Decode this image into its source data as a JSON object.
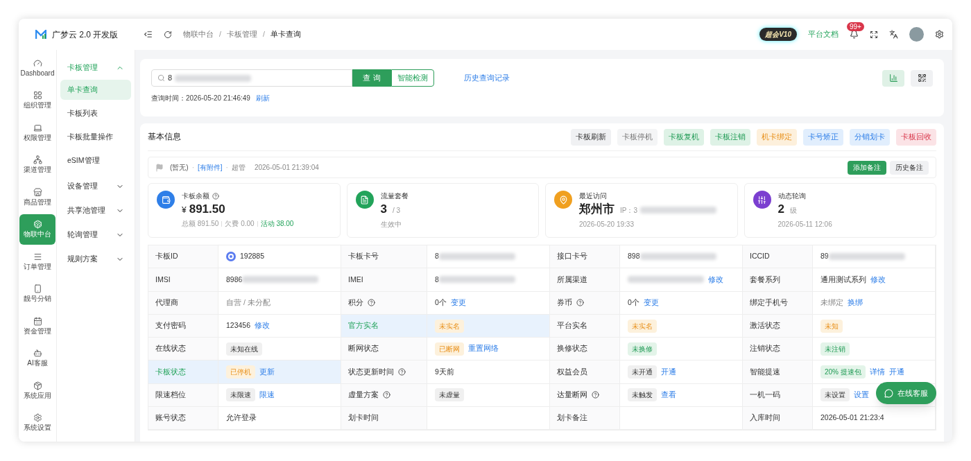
{
  "brand": {
    "name": "广梦云 2.0 开发版"
  },
  "rail": [
    {
      "label": "Dashboard",
      "selected": false
    },
    {
      "label": "组织管理",
      "selected": false
    },
    {
      "label": "权限管理",
      "selected": false
    },
    {
      "label": "渠道管理",
      "selected": false
    },
    {
      "label": "商品管理",
      "selected": false
    },
    {
      "label": "物联中台",
      "selected": true
    },
    {
      "label": "订单管理",
      "selected": false
    },
    {
      "label": "靓号分销",
      "selected": false
    },
    {
      "label": "资金管理",
      "selected": false
    },
    {
      "label": "AI客服",
      "selected": false
    },
    {
      "label": "系统应用",
      "selected": false
    },
    {
      "label": "系统设置",
      "selected": false
    }
  ],
  "submenu": [
    {
      "label": "卡板管理",
      "expanded": true,
      "children": [
        {
          "label": "单卡查询",
          "selected": true
        },
        {
          "label": "卡板列表",
          "selected": false
        },
        {
          "label": "卡板批量操作",
          "selected": false
        },
        {
          "label": "eSIM管理",
          "selected": false
        }
      ]
    },
    {
      "label": "设备管理",
      "expanded": false
    },
    {
      "label": "共享池管理",
      "expanded": false
    },
    {
      "label": "轮询管理",
      "expanded": false
    },
    {
      "label": "规则方案",
      "expanded": false
    }
  ],
  "breadcrumb": {
    "separator": "/",
    "items": [
      "物联中台",
      "卡板管理",
      "单卡查询"
    ]
  },
  "header": {
    "vip_badge": "超会V10",
    "docs_link": "平台文档",
    "notification_count": "99+"
  },
  "search": {
    "value": "8",
    "query_button": "查 询",
    "detect_button": "智能检测",
    "history_link": "历史查询记录",
    "query_time": "查询时间：2026-05-20 21:46:49",
    "refresh_link": "刷新"
  },
  "basic_info": {
    "title": "基本信息",
    "actions": [
      {
        "label": "卡板刷新",
        "kind": "neutral"
      },
      {
        "label": "卡板停机",
        "kind": "muted"
      },
      {
        "label": "卡板复机",
        "kind": "success"
      },
      {
        "label": "卡板注销",
        "kind": "success"
      },
      {
        "label": "机卡绑定",
        "kind": "warning"
      },
      {
        "label": "卡号矫正",
        "kind": "info"
      },
      {
        "label": "分销划卡",
        "kind": "info"
      },
      {
        "label": "卡板回收",
        "kind": "danger"
      }
    ],
    "note": {
      "separator": "·",
      "text": "(暂无)",
      "attachment": "[有附件]",
      "author": "超管",
      "time": "2026-05-01 21:39:04",
      "add_button": "添加备注",
      "history_button": "历史备注"
    },
    "stats": [
      {
        "title": "卡板余额",
        "help": true,
        "color": "#2f7fe8",
        "value": "891.50",
        "prefix": "¥",
        "sub": [
          {
            "text": "总额 891.50",
            "highlight": false
          },
          {
            "text": "欠费 0.00",
            "highlight": false
          },
          {
            "text": "活动 38.00",
            "highlight": true
          }
        ]
      },
      {
        "title": "流量套餐",
        "color": "#22a35a",
        "value": "3",
        "unit": "/ 3",
        "sub": [
          {
            "text": "生效中",
            "highlight": false
          }
        ]
      },
      {
        "title": "最近访问",
        "color": "#f0a020",
        "value": "郑州市",
        "unit": "IP：3",
        "masked": true,
        "sub": [
          {
            "text": "2026-05-20 19:33",
            "highlight": false
          }
        ]
      },
      {
        "title": "动态轮询",
        "color": "#7b3fd0",
        "value": "2",
        "unit": "级",
        "sub": [
          {
            "text": "2026-05-11 12:06",
            "highlight": false
          }
        ]
      }
    ],
    "rows": [
      [
        {
          "label": "卡板ID",
          "highlight": false,
          "value": [
            {
              "kind": "logo"
            },
            {
              "kind": "text",
              "text": "192885"
            }
          ]
        },
        {
          "label": "卡板卡号",
          "highlight": false,
          "value": [
            {
              "kind": "masked",
              "text": "8"
            }
          ]
        },
        {
          "label": "接口卡号",
          "highlight": false,
          "value": [
            {
              "kind": "masked",
              "text": "898"
            }
          ]
        },
        {
          "label": "ICCID",
          "highlight": false,
          "value": [
            {
              "kind": "masked",
              "text": "89"
            }
          ]
        }
      ],
      [
        {
          "label": "IMSI",
          "highlight": false,
          "value": [
            {
              "kind": "masked",
              "text": "8986"
            }
          ]
        },
        {
          "label": "IMEI",
          "highlight": false,
          "value": [
            {
              "kind": "masked",
              "text": "8"
            }
          ]
        },
        {
          "label": "所属渠道",
          "highlight": false,
          "value": [
            {
              "kind": "masked"
            },
            {
              "kind": "link",
              "text": "修改"
            }
          ]
        },
        {
          "label": "套餐系列",
          "highlight": false,
          "value": [
            {
              "kind": "text",
              "text": "通用测试系列"
            },
            {
              "kind": "link",
              "text": "修改"
            }
          ]
        }
      ],
      [
        {
          "label": "代理商",
          "highlight": false,
          "value": [
            {
              "kind": "muted",
              "text": "自营 / 未分配"
            }
          ]
        },
        {
          "label": "积分",
          "help": true,
          "highlight": false,
          "value": [
            {
              "kind": "text",
              "text": "0个"
            },
            {
              "kind": "link",
              "text": "变更"
            }
          ]
        },
        {
          "label": "券币",
          "help": true,
          "highlight": false,
          "value": [
            {
              "kind": "text",
              "text": "0个"
            },
            {
              "kind": "link",
              "text": "变更"
            }
          ]
        },
        {
          "label": "绑定手机号",
          "highlight": false,
          "value": [
            {
              "kind": "muted",
              "text": "未绑定"
            },
            {
              "kind": "link",
              "text": "换绑"
            }
          ]
        }
      ],
      [
        {
          "label": "支付密码",
          "highlight": false,
          "value": [
            {
              "kind": "text",
              "text": "123456"
            },
            {
              "kind": "link",
              "text": "修改"
            }
          ]
        },
        {
          "label": "官方实名",
          "highlight": true,
          "value": [
            {
              "kind": "warning",
              "text": "未实名"
            }
          ]
        },
        {
          "label": "平台实名",
          "highlight": false,
          "value": [
            {
              "kind": "warning",
              "text": "未实名"
            }
          ]
        },
        {
          "label": "激活状态",
          "highlight": false,
          "value": [
            {
              "kind": "warning",
              "text": "未知"
            }
          ]
        }
      ],
      [
        {
          "label": "在线状态",
          "highlight": false,
          "value": [
            {
              "kind": "neutral",
              "text": "未知在线"
            }
          ]
        },
        {
          "label": "断网状态",
          "highlight": false,
          "value": [
            {
              "kind": "warning",
              "text": "已断网"
            },
            {
              "kind": "link",
              "text": "重置网络"
            }
          ]
        },
        {
          "label": "换修状态",
          "highlight": false,
          "value": [
            {
              "kind": "success",
              "text": "未换修"
            }
          ]
        },
        {
          "label": "注销状态",
          "highlight": false,
          "value": [
            {
              "kind": "success",
              "text": "未注销"
            }
          ]
        }
      ],
      [
        {
          "label": "卡板状态",
          "highlight": true,
          "value": [
            {
              "kind": "warning",
              "text": "已停机"
            },
            {
              "kind": "link",
              "text": "更新"
            }
          ]
        },
        {
          "label": "状态更新时间",
          "help": true,
          "highlight": false,
          "value": [
            {
              "kind": "text",
              "text": "9天前"
            }
          ]
        },
        {
          "label": "权益会员",
          "highlight": false,
          "value": [
            {
              "kind": "neutral",
              "text": "未开通"
            },
            {
              "kind": "link",
              "text": "开通"
            }
          ]
        },
        {
          "label": "智能提速",
          "highlight": false,
          "value": [
            {
              "kind": "success",
              "text": "20% 提速包"
            },
            {
              "kind": "link",
              "text": "详情"
            },
            {
              "kind": "link",
              "text": "开通"
            }
          ]
        }
      ],
      [
        {
          "label": "限速档位",
          "highlight": false,
          "value": [
            {
              "kind": "neutral",
              "text": "未限速"
            },
            {
              "kind": "link",
              "text": "限速"
            }
          ]
        },
        {
          "label": "虚量方案",
          "help": true,
          "highlight": false,
          "value": [
            {
              "kind": "neutral",
              "text": "未虚量"
            }
          ]
        },
        {
          "label": "达量断网",
          "help": true,
          "highlight": false,
          "value": [
            {
              "kind": "neutral",
              "text": "未触发"
            },
            {
              "kind": "link",
              "text": "查看"
            }
          ]
        },
        {
          "label": "一机一码",
          "highlight": false,
          "value": [
            {
              "kind": "neutral",
              "text": "未设置"
            },
            {
              "kind": "link",
              "text": "设置"
            }
          ]
        }
      ],
      [
        {
          "label": "账号状态",
          "highlight": false,
          "value": [
            {
              "kind": "text",
              "text": "允许登录"
            }
          ]
        },
        {
          "label": "划卡时间",
          "highlight": false
        },
        {
          "label": "划卡备注",
          "highlight": false
        },
        {
          "label": "入库时间",
          "highlight": false,
          "value": [
            {
              "kind": "text",
              "text": "2026-05-01 21:23:4"
            }
          ]
        }
      ]
    ]
  },
  "chat_button": "在线客服"
}
